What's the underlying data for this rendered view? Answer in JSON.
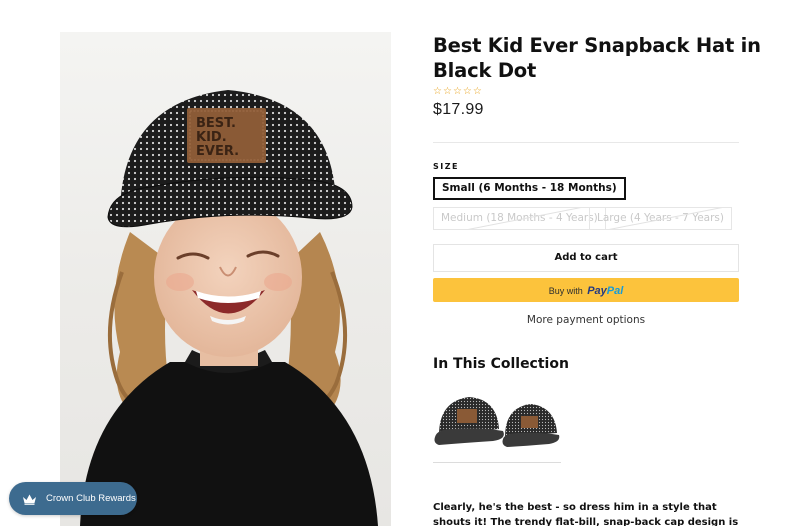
{
  "product": {
    "title": "Best Kid Ever Snapback Hat in Black Dot",
    "rating_stars": [
      "☆",
      "☆",
      "☆",
      "☆",
      "☆"
    ],
    "price": "$17.99",
    "image_alt": "Child laughing wearing a black polka dot snapback hat with a leather patch",
    "hat_patch_text": [
      "BEST.",
      "KID.",
      "EVER."
    ]
  },
  "options": {
    "size_label": "SIZE",
    "sizes": [
      {
        "label": "Small (6 Months - 18 Months)",
        "selected": true,
        "available": true
      },
      {
        "label": "Medium (18 Months - 4 Years)",
        "selected": false,
        "available": false
      },
      {
        "label": "Large (4 Years - 7 Years)",
        "selected": false,
        "available": false
      }
    ]
  },
  "actions": {
    "add_to_cart": "Add to cart",
    "buy_with": "Buy with",
    "paypal_pay": "Pay",
    "paypal_pal": "Pal",
    "more_payment_options": "More payment options"
  },
  "collection": {
    "heading": "In This Collection"
  },
  "description": {
    "text": "Clearly, he's the best - so dress him in a style that shouts it! The trendy flat-bill, snap-back cap design is available in a variety of"
  },
  "rewards": {
    "label": "Crown Club Rewards"
  },
  "colors": {
    "star": "#e8a21a",
    "paypal_button": "#fcc33c",
    "paypal_dark": "#253b80",
    "paypal_light": "#179bd7",
    "rewards_button": "#3d6b8f"
  }
}
